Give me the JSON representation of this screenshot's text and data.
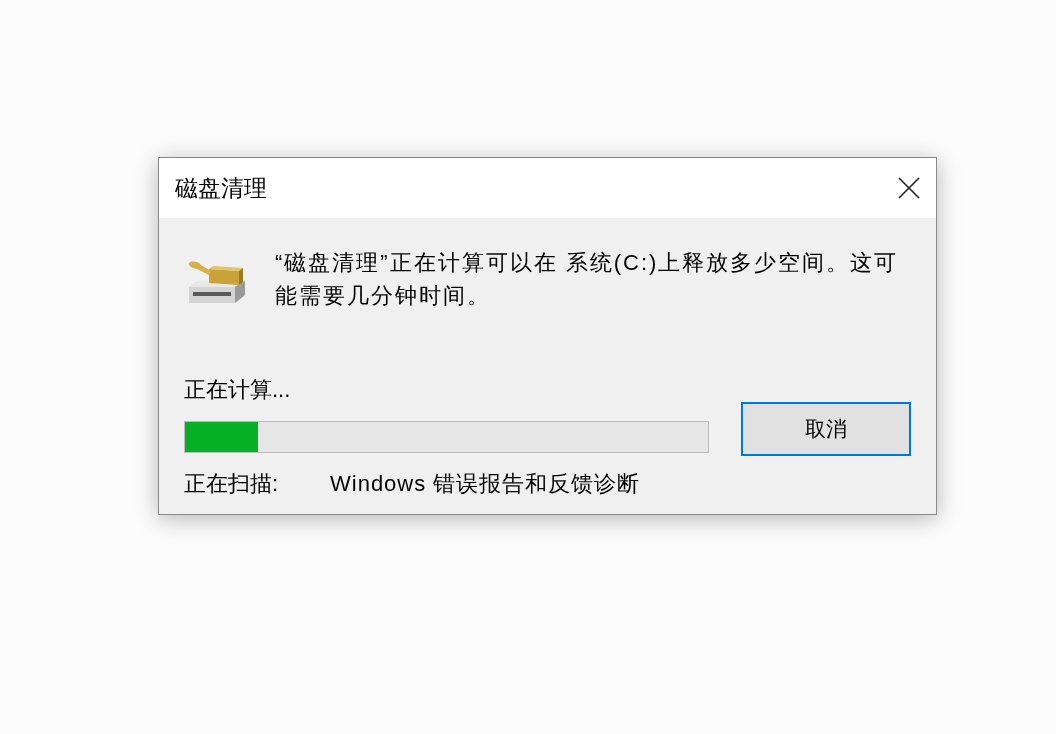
{
  "window": {
    "title": "磁盘清理"
  },
  "message": "“磁盘清理”正在计算可以在 系统(C:)上释放多少空间。这可能需要几分钟时间。",
  "status": {
    "label": "正在计算..."
  },
  "progress": {
    "level": 0.14
  },
  "scan": {
    "label": "正在扫描:",
    "item": "Windows 错误报告和反馈诊断"
  },
  "buttons": [
    {
      "label": "取消",
      "focused": true
    }
  ]
}
